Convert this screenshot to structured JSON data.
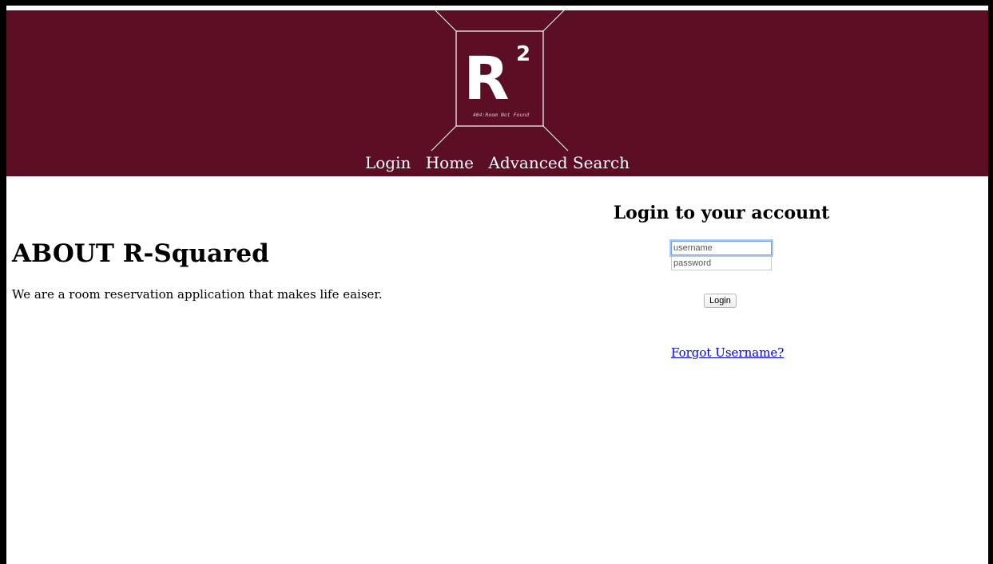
{
  "header": {
    "logo": {
      "letter": "R",
      "superscript": "2",
      "tagline": "404:Room Not Found"
    },
    "nav": [
      {
        "label": "Login"
      },
      {
        "label": "Home"
      },
      {
        "label": "Advanced Search"
      }
    ],
    "background_color": "#5c0e25"
  },
  "about": {
    "title": "ABOUT R-Squared",
    "text": "We are a room reservation application that makes life eaiser."
  },
  "login": {
    "title": "Login to your account",
    "username_placeholder": "username",
    "password_placeholder": "password",
    "button_label": "Login",
    "forgot_link": "Forgot Username?"
  }
}
